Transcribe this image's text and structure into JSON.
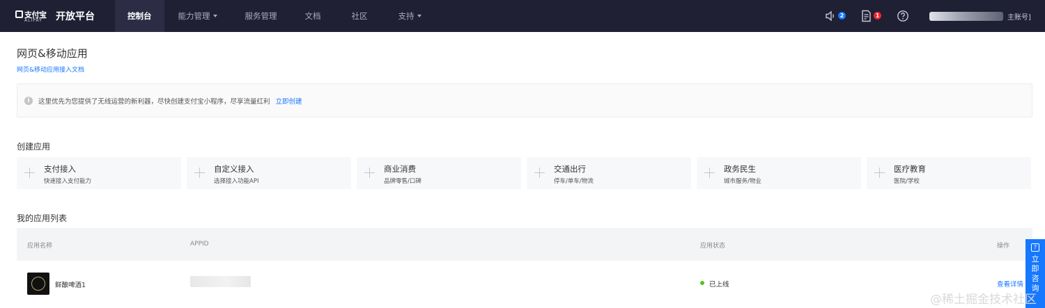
{
  "nav": {
    "logo_text": "支付宝",
    "logo_subtext": "ALIPAY",
    "brand_title": "开放平台",
    "items": [
      {
        "label": "控制台",
        "active": true,
        "dropdown": false
      },
      {
        "label": "能力管理",
        "active": false,
        "dropdown": true
      },
      {
        "label": "服务管理",
        "active": false,
        "dropdown": false
      },
      {
        "label": "文档",
        "active": false,
        "dropdown": false
      },
      {
        "label": "社区",
        "active": false,
        "dropdown": false
      },
      {
        "label": "支持",
        "active": false,
        "dropdown": true
      }
    ],
    "icons": {
      "notifications": {
        "icon": "speaker-icon",
        "count": "2",
        "badge_color": "#1677ff"
      },
      "messages": {
        "icon": "document-icon",
        "count": "1",
        "badge_color": "#f5222d"
      },
      "help": {
        "icon": "help-icon"
      }
    },
    "account_label": "主账号]"
  },
  "page": {
    "title": "网页&移动应用",
    "doc_link": "网页&移动应用接入文档"
  },
  "notice": {
    "text": "这里优先为您提供了无线运营的新利器，尽快创建支付宝小程序，尽享流量红利",
    "link": "立即创建"
  },
  "create_section": {
    "title": "创建应用",
    "cards": [
      {
        "title": "支付接入",
        "subtitle": "快速接入支付能力"
      },
      {
        "title": "自定义接入",
        "subtitle": "选择接入功能API"
      },
      {
        "title": "商业消费",
        "subtitle": "品牌零售/口碑"
      },
      {
        "title": "交通出行",
        "subtitle": "停车/单车/物流"
      },
      {
        "title": "政务民生",
        "subtitle": "城市服务/物业"
      },
      {
        "title": "医疗教育",
        "subtitle": "医院/学校"
      }
    ]
  },
  "app_list": {
    "title": "我的应用列表",
    "columns": [
      "应用名称",
      "APPID",
      "应用状态",
      "操作"
    ],
    "rows": [
      {
        "name": "鲜酿啤酒1",
        "appid": "",
        "status": "已上线",
        "status_color": "#52c41a",
        "action": "查看详情"
      }
    ]
  },
  "consult": {
    "label": "立即咨询"
  },
  "watermark": "@稀土掘金技术社区",
  "colors": {
    "nav_bg": "#1f2034",
    "link": "#1677ff"
  }
}
